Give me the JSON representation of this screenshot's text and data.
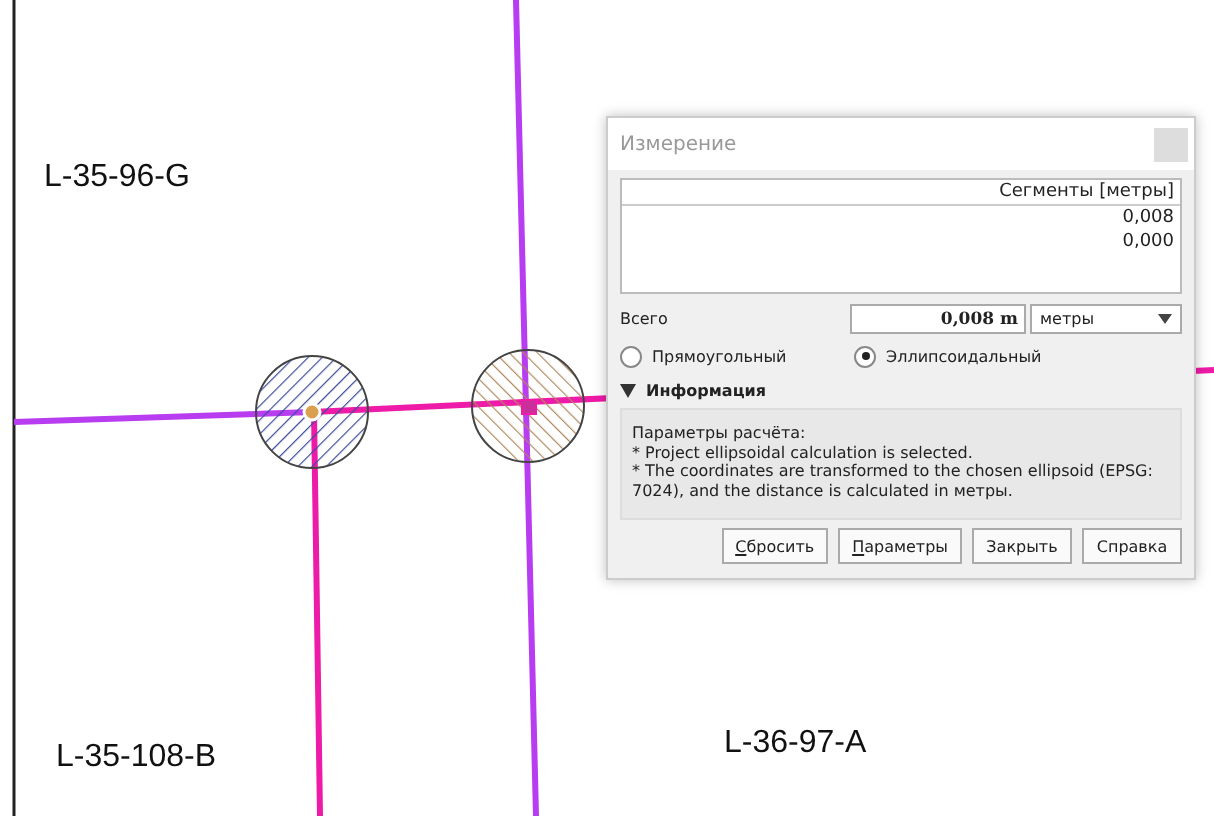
{
  "map": {
    "labels": [
      {
        "text": "L-35-96-G"
      },
      {
        "text": "L-35-108-B"
      },
      {
        "text": "L-36-97-A"
      }
    ]
  },
  "dialog": {
    "title": "Измерение",
    "table": {
      "columns": [
        "Сегменты [метры]"
      ],
      "rows": [
        "0,008",
        "0,000"
      ]
    },
    "total": {
      "label": "Всего",
      "value": "0,008 m",
      "unit": "метры"
    },
    "modes": [
      {
        "label": "Прямоугольный",
        "selected": false
      },
      {
        "label": "Эллипсоидальный",
        "selected": true
      }
    ],
    "info": {
      "title": "Информация",
      "expanded": true,
      "lines": [
        "Параметры расчёта:",
        "* Project ellipsoidal calculation is selected.",
        "* The coordinates are transformed to the chosen ellipsoid (EPSG: 7024), and the distance is calculated in метры."
      ]
    },
    "buttons": [
      {
        "label": "Сбросить",
        "mnemonic": true
      },
      {
        "label": "Параметры",
        "mnemonic": true
      },
      {
        "label": "Закрыть",
        "mnemonic": false
      },
      {
        "label": "Справка",
        "mnemonic": false
      }
    ]
  }
}
